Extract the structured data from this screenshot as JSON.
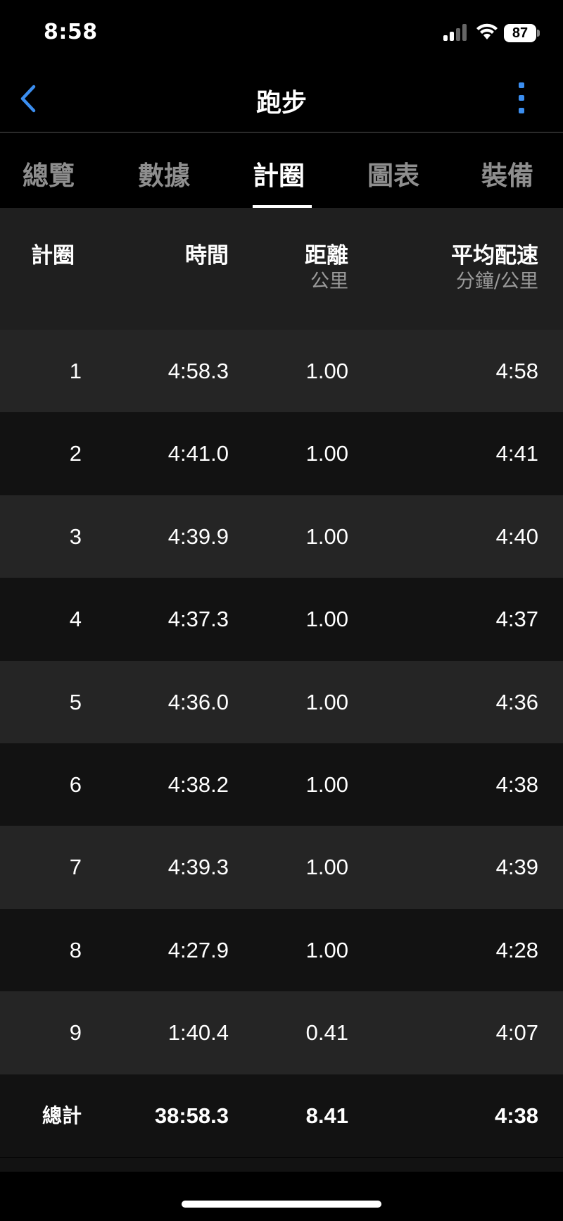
{
  "status_bar": {
    "time": "8:58",
    "battery": "87"
  },
  "header": {
    "title": "跑步",
    "back_icon": "chevron-left-icon",
    "more_icon": "vertical-ellipsis-icon",
    "accent_color": "#3b8ef0"
  },
  "tabs": [
    {
      "label": "總覽",
      "active": false
    },
    {
      "label": "數據",
      "active": false
    },
    {
      "label": "計圈",
      "active": true
    },
    {
      "label": "圖表",
      "active": false
    },
    {
      "label": "裝備",
      "active": false
    }
  ],
  "table": {
    "columns": [
      {
        "label": "計圈",
        "unit": ""
      },
      {
        "label": "時間",
        "unit": ""
      },
      {
        "label": "距離",
        "unit": "公里"
      },
      {
        "label": "平均配速",
        "unit": "分鐘/公里"
      }
    ],
    "rows": [
      {
        "lap": "1",
        "time": "4:58.3",
        "distance": "1.00",
        "pace": "4:58"
      },
      {
        "lap": "2",
        "time": "4:41.0",
        "distance": "1.00",
        "pace": "4:41"
      },
      {
        "lap": "3",
        "time": "4:39.9",
        "distance": "1.00",
        "pace": "4:40"
      },
      {
        "lap": "4",
        "time": "4:37.3",
        "distance": "1.00",
        "pace": "4:37"
      },
      {
        "lap": "5",
        "time": "4:36.0",
        "distance": "1.00",
        "pace": "4:36"
      },
      {
        "lap": "6",
        "time": "4:38.2",
        "distance": "1.00",
        "pace": "4:38"
      },
      {
        "lap": "7",
        "time": "4:39.3",
        "distance": "1.00",
        "pace": "4:39"
      },
      {
        "lap": "8",
        "time": "4:27.9",
        "distance": "1.00",
        "pace": "4:28"
      },
      {
        "lap": "9",
        "time": "1:40.4",
        "distance": "0.41",
        "pace": "4:07"
      }
    ],
    "total": {
      "lap": "總計",
      "time": "38:58.3",
      "distance": "8.41",
      "pace": "4:38"
    }
  }
}
